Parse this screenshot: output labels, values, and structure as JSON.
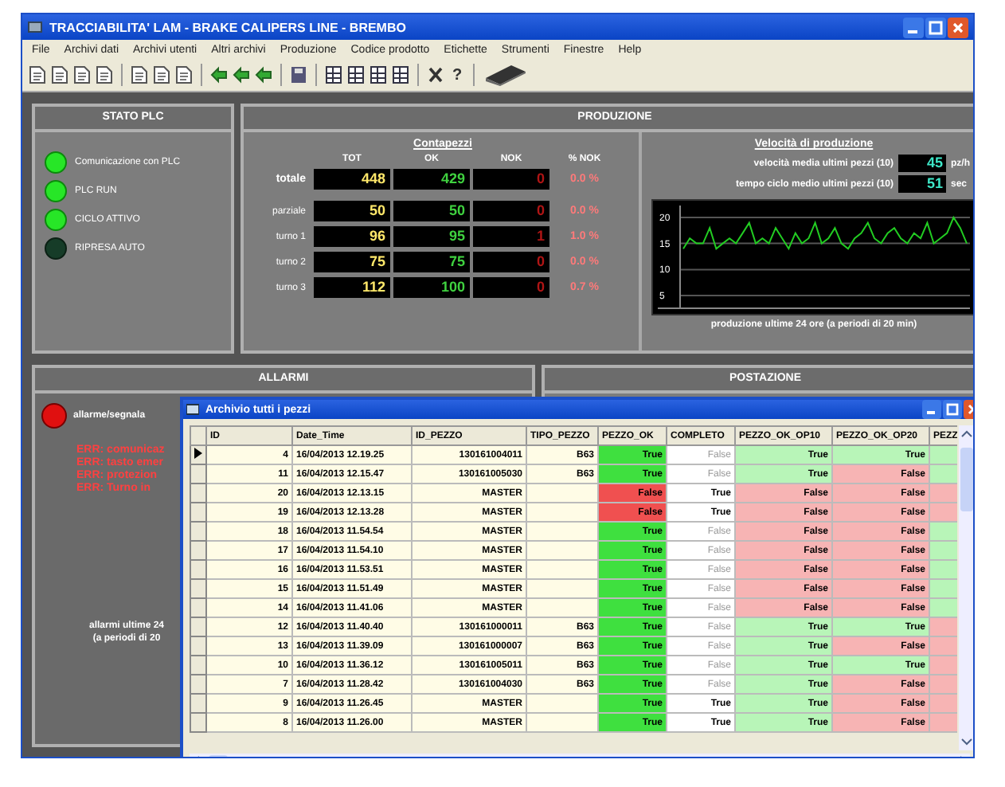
{
  "window": {
    "title": "TRACCIABILITA' LAM - BRAKE CALIPERS LINE - BREMBO"
  },
  "menu": [
    "File",
    "Archivi dati",
    "Archivi utenti",
    "Altri archivi",
    "Produzione",
    "Codice prodotto",
    "Etichette",
    "Strumenti",
    "Finestre",
    "Help"
  ],
  "toolbar": [
    {
      "kind": "doc"
    },
    {
      "kind": "doc"
    },
    {
      "kind": "doc"
    },
    {
      "kind": "doc"
    },
    {
      "kind": "sep"
    },
    {
      "kind": "doc"
    },
    {
      "kind": "doc"
    },
    {
      "kind": "doc"
    },
    {
      "kind": "sep"
    },
    {
      "kind": "arrow"
    },
    {
      "kind": "arrow"
    },
    {
      "kind": "arrow"
    },
    {
      "kind": "sep"
    },
    {
      "kind": "disk"
    },
    {
      "kind": "sep"
    },
    {
      "kind": "grid"
    },
    {
      "kind": "grid"
    },
    {
      "kind": "grid"
    },
    {
      "kind": "grid"
    },
    {
      "kind": "sep"
    },
    {
      "kind": "close"
    },
    {
      "kind": "text",
      "label": "?"
    },
    {
      "kind": "sep"
    },
    {
      "kind": "device"
    }
  ],
  "plc": {
    "title": "STATO PLC",
    "leds": [
      {
        "label": "Comunicazione con PLC",
        "on": true
      },
      {
        "label": "PLC RUN",
        "on": true
      },
      {
        "label": "CICLO ATTIVO",
        "on": true
      },
      {
        "label": "RIPRESA AUTO",
        "on": false
      }
    ]
  },
  "produzione": {
    "title": "PRODUZIONE",
    "contapezzi": {
      "title": "Contapezzi",
      "columns": [
        "TOT",
        "OK",
        "NOK",
        "% NOK"
      ],
      "rows": [
        {
          "label": "totale",
          "tot": "448",
          "ok": "429",
          "nok": "0",
          "pct": "0.0 %"
        },
        {
          "label": "parziale",
          "tot": "50",
          "ok": "50",
          "nok": "0",
          "pct": "0.0 %"
        },
        {
          "label": "turno 1",
          "tot": "96",
          "ok": "95",
          "nok": "1",
          "pct": "1.0 %"
        },
        {
          "label": "turno 2",
          "tot": "75",
          "ok": "75",
          "nok": "0",
          "pct": "0.0 %"
        },
        {
          "label": "turno 3",
          "tot": "112",
          "ok": "100",
          "nok": "0",
          "pct": "0.7 %"
        }
      ]
    },
    "velocita": {
      "title": "Velocità di produzione",
      "readings": [
        {
          "label": "velocità media ultimi pezzi (10)",
          "value": "45",
          "unit": "pz/h"
        },
        {
          "label": "tempo ciclo medio ultimi pezzi (10)",
          "value": "51",
          "unit": "sec"
        }
      ],
      "chart_data": {
        "type": "line",
        "ylim": [
          3,
          22
        ],
        "grid": true,
        "yticks": [
          {
            "value": 5,
            "label": "5"
          },
          {
            "value": 10,
            "label": "10"
          },
          {
            "value": 15,
            "label": "15"
          },
          {
            "value": 20,
            "label": "20"
          }
        ],
        "series": [
          {
            "color": "#22cc22",
            "values": [
              14,
              16,
              15,
              15,
              18,
              14,
              15,
              16,
              15,
              17,
              19,
              15,
              16,
              15,
              18,
              16,
              14,
              17,
              15,
              16,
              19,
              15,
              16,
              18,
              15,
              14,
              16,
              17,
              19,
              16,
              15,
              17,
              18,
              16,
              15,
              17,
              16,
              19,
              15,
              16,
              17,
              20,
              18,
              15
            ]
          }
        ]
      },
      "caption": "produzione ultime 24 ore (a periodi di 20 min)"
    }
  },
  "allarmi": {
    "title": "ALLARMI",
    "status": "allarme/segnala",
    "lines": [
      "ERR: comunicaz",
      "ERR: tasto emer",
      "ERR: protezion",
      "ERR: Turno in"
    ],
    "footer": [
      "allarmi ultime 24",
      "(a periodi di 20"
    ]
  },
  "postazione": {
    "title": "POSTAZIONE"
  },
  "archive": {
    "title": "Archivio tutti i pezzi",
    "columns": [
      "ID",
      "Date_Time",
      "ID_PEZZO",
      "TIPO_PEZZO",
      "PEZZO_OK",
      "COMPLETO",
      "PEZZO_OK_OP10",
      "PEZZO_OK_OP20",
      "PEZZ"
    ],
    "rows": [
      {
        "current": true,
        "id": "4",
        "date_time": "16/04/2013 12.19.25",
        "id_pezzo": "130161004011",
        "tipo": "B63",
        "ok": {
          "text": "True",
          "value": true
        },
        "completo": {
          "text": "False",
          "value": false
        },
        "op10": {
          "text": "True",
          "value": true
        },
        "op20": {
          "text": "True",
          "value": true
        },
        "last_ok": true
      },
      {
        "current": false,
        "id": "11",
        "date_time": "16/04/2013 12.15.47",
        "id_pezzo": "130161005030",
        "tipo": "B63",
        "ok": {
          "text": "True",
          "value": true
        },
        "completo": {
          "text": "False",
          "value": false
        },
        "op10": {
          "text": "True",
          "value": true
        },
        "op20": {
          "text": "False",
          "value": false
        },
        "last_ok": true
      },
      {
        "current": false,
        "id": "20",
        "date_time": "16/04/2013 12.13.15",
        "id_pezzo": "MASTER",
        "ok": {
          "text": "False",
          "value": false
        },
        "completo": {
          "text": "True",
          "value": true
        },
        "op10": {
          "text": "False",
          "value": false
        },
        "op20": {
          "text": "False",
          "value": false
        },
        "last_ok": false
      },
      {
        "current": false,
        "id": "19",
        "date_time": "16/04/2013 12.13.28",
        "id_pezzo": "MASTER",
        "ok": {
          "text": "False",
          "value": false
        },
        "completo": {
          "text": "True",
          "value": true
        },
        "op10": {
          "text": "False",
          "value": false
        },
        "op20": {
          "text": "False",
          "value": false
        },
        "last_ok": false
      },
      {
        "current": false,
        "id": "18",
        "date_time": "16/04/2013 11.54.54",
        "id_pezzo": "MASTER",
        "ok": {
          "text": "True",
          "value": true
        },
        "completo": {
          "text": "False",
          "value": false
        },
        "op10": {
          "text": "False",
          "value": false
        },
        "op20": {
          "text": "False",
          "value": false
        },
        "last_ok": true
      },
      {
        "current": false,
        "id": "17",
        "date_time": "16/04/2013 11.54.10",
        "id_pezzo": "MASTER",
        "ok": {
          "text": "True",
          "value": true
        },
        "completo": {
          "text": "False",
          "value": false
        },
        "op10": {
          "text": "False",
          "value": false
        },
        "op20": {
          "text": "False",
          "value": false
        },
        "last_ok": true
      },
      {
        "current": false,
        "id": "16",
        "date_time": "16/04/2013 11.53.51",
        "id_pezzo": "MASTER",
        "ok": {
          "text": "True",
          "value": true
        },
        "completo": {
          "text": "False",
          "value": false
        },
        "op10": {
          "text": "False",
          "value": false
        },
        "op20": {
          "text": "False",
          "value": false
        },
        "last_ok": true
      },
      {
        "current": false,
        "id": "15",
        "date_time": "16/04/2013 11.51.49",
        "id_pezzo": "MASTER",
        "ok": {
          "text": "True",
          "value": true
        },
        "completo": {
          "text": "False",
          "value": false
        },
        "op10": {
          "text": "False",
          "value": false
        },
        "op20": {
          "text": "False",
          "value": false
        },
        "last_ok": true
      },
      {
        "current": false,
        "id": "14",
        "date_time": "16/04/2013 11.41.06",
        "id_pezzo": "MASTER",
        "ok": {
          "text": "True",
          "value": true
        },
        "completo": {
          "text": "False",
          "value": false
        },
        "op10": {
          "text": "False",
          "value": false
        },
        "op20": {
          "text": "False",
          "value": false
        },
        "last_ok": true
      },
      {
        "current": false,
        "id": "12",
        "date_time": "16/04/2013 11.40.40",
        "id_pezzo": "130161000011",
        "tipo": "B63",
        "ok": {
          "text": "True",
          "value": true
        },
        "completo": {
          "text": "False",
          "value": false
        },
        "op10": {
          "text": "True",
          "value": true
        },
        "op20": {
          "text": "True",
          "value": true
        },
        "last_ok": false
      },
      {
        "current": false,
        "id": "13",
        "date_time": "16/04/2013 11.39.09",
        "id_pezzo": "130161000007",
        "tipo": "B63",
        "ok": {
          "text": "True",
          "value": true
        },
        "completo": {
          "text": "False",
          "value": false
        },
        "op10": {
          "text": "True",
          "value": true
        },
        "op20": {
          "text": "False",
          "value": false
        },
        "last_ok": false
      },
      {
        "current": false,
        "id": "10",
        "date_time": "16/04/2013 11.36.12",
        "id_pezzo": "130161005011",
        "tipo": "B63",
        "ok": {
          "text": "True",
          "value": true
        },
        "completo": {
          "text": "False",
          "value": false
        },
        "op10": {
          "text": "True",
          "value": true
        },
        "op20": {
          "text": "True",
          "value": true
        },
        "last_ok": false
      },
      {
        "current": false,
        "id": "7",
        "date_time": "16/04/2013 11.28.42",
        "id_pezzo": "130161004030",
        "tipo": "B63",
        "ok": {
          "text": "True",
          "value": true
        },
        "completo": {
          "text": "False",
          "value": false
        },
        "op10": {
          "text": "True",
          "value": true
        },
        "op20": {
          "text": "False",
          "value": false
        },
        "last_ok": false
      },
      {
        "current": false,
        "id": "9",
        "date_time": "16/04/2013 11.26.45",
        "id_pezzo": "MASTER",
        "ok": {
          "text": "True",
          "value": true
        },
        "completo": {
          "text": "True",
          "value": true
        },
        "op10": {
          "text": "True",
          "value": true
        },
        "op20": {
          "text": "False",
          "value": false
        },
        "last_ok": false
      },
      {
        "current": false,
        "id": "8",
        "date_time": "16/04/2013 11.26.00",
        "id_pezzo": "MASTER",
        "ok": {
          "text": "True",
          "value": true
        },
        "completo": {
          "text": "True",
          "value": true
        },
        "op10": {
          "text": "True",
          "value": true
        },
        "op20": {
          "text": "False",
          "value": false
        },
        "last_ok": false
      }
    ]
  }
}
